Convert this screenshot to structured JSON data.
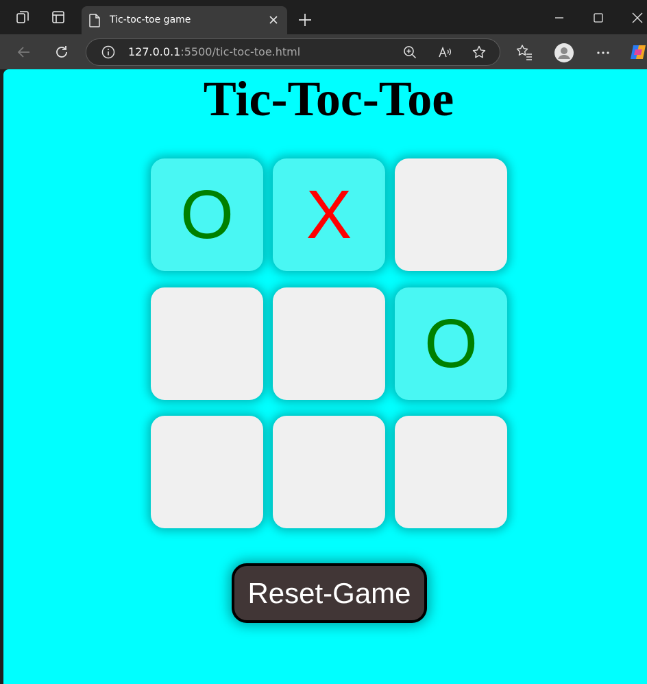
{
  "browser": {
    "tab_title": "Tic-toc-toe game",
    "url_host": "127.0.0.1",
    "url_path": ":5500/tic-toc-toe.html"
  },
  "page": {
    "title": "Tic-Toc-Toe",
    "reset_label": "Reset-Game"
  },
  "board": {
    "cells": [
      "O",
      "X",
      "",
      "",
      "",
      "O",
      "",
      "",
      ""
    ]
  },
  "colors": {
    "page_background": "#00ffff",
    "filled_cell": "#49f7f3",
    "empty_cell": "#f0f0f0",
    "o_mark": "#008000",
    "x_mark": "#ff0000",
    "reset_button": "#413636"
  }
}
